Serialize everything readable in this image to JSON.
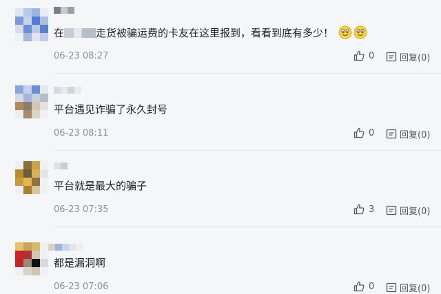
{
  "comments": [
    {
      "text_prefix": "在",
      "text_suffix": "走货被骗运费的卡友在这里报到，看看到底有多少！",
      "emojis": [
        "smile-emoji",
        "smile-emoji"
      ],
      "time": "06-23 08:27",
      "likes": "0",
      "reply_label": "回复(0)"
    },
    {
      "text": "平台遇见诈骗了永久封号",
      "time": "06-23 08:11",
      "likes": "0",
      "reply_label": "回复(0)"
    },
    {
      "text": "平台就是最大的骗子",
      "time": "06-23 07:35",
      "likes": "3",
      "reply_label": "回复(0)"
    },
    {
      "text": "都是漏洞啊",
      "time": "06-23 07:06",
      "likes": "0",
      "reply_label": "回复(0)"
    }
  ],
  "icons": {
    "like": "thumbs-up-icon",
    "reply": "reply-box-icon"
  },
  "colors": {
    "background": "#f5f6f8",
    "text": "#222222",
    "meta": "#8a8f98"
  }
}
